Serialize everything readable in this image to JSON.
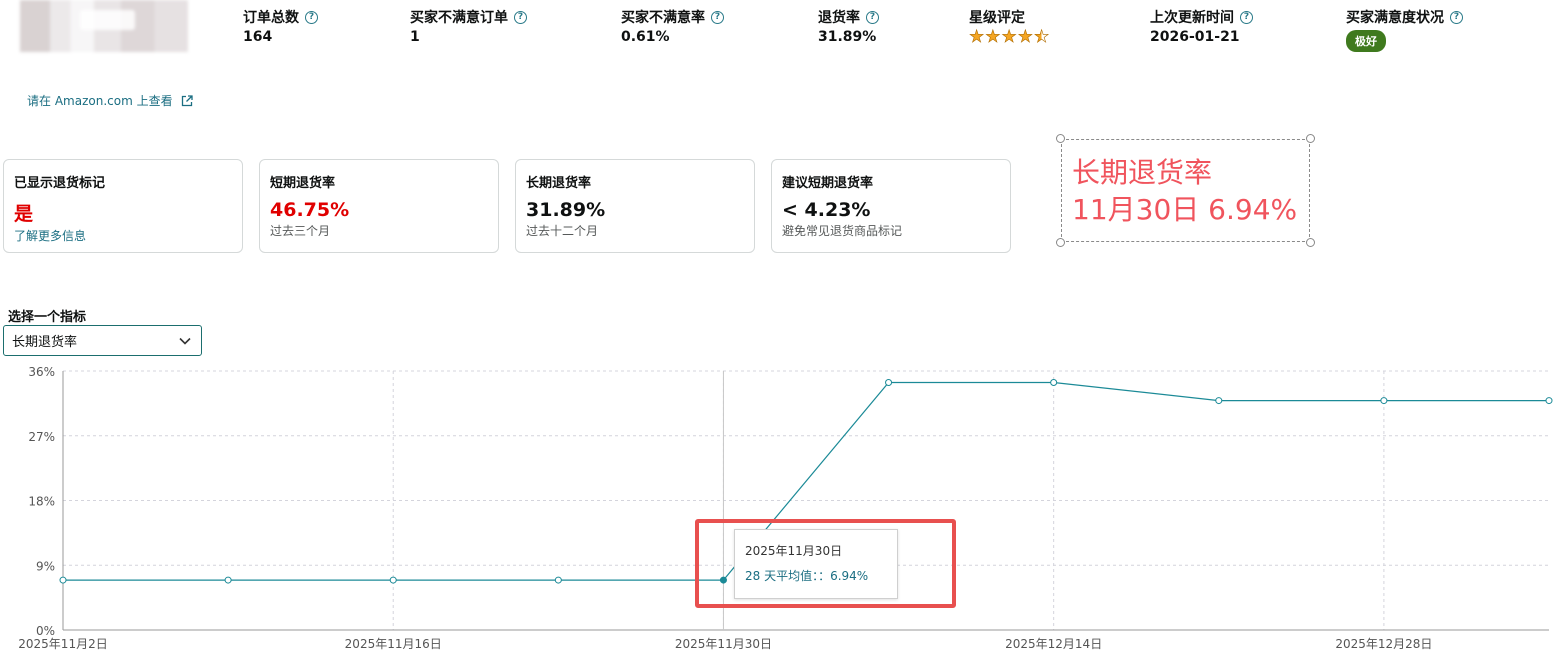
{
  "metrics": [
    {
      "label": "订单总数",
      "value": "164"
    },
    {
      "label": "买家不满意订单",
      "value": "1"
    },
    {
      "label": "买家不满意率",
      "value": "0.61%"
    },
    {
      "label": "退货率",
      "value": "31.89%"
    },
    {
      "label": "星级评定",
      "rating": 4.5
    },
    {
      "label": "上次更新时间",
      "value": "2026-01-21"
    },
    {
      "label": "买家满意度状况",
      "badge": "极好"
    }
  ],
  "amazon_link": "请在 Amazon.com 上查看",
  "cards": [
    {
      "title": "已显示退货标记",
      "value": "是",
      "sub": "了解更多信息"
    },
    {
      "title": "短期退货率",
      "value": "46.75%",
      "sub": "过去三个月"
    },
    {
      "title": "长期退货率",
      "value": "31.89%",
      "sub": "过去十二个月"
    },
    {
      "title": "建议短期退货率",
      "value": "< 4.23%",
      "sub": "避免常见退货商品标记"
    }
  ],
  "annotation": {
    "line1": "长期退货率",
    "line2": "11月30日 6.94%"
  },
  "selector": {
    "label": "选择一个指标",
    "selected": "长期退货率"
  },
  "tooltip": {
    "date": "2025年11月30日",
    "value": "28 天平均值：：6.94%"
  },
  "colors": {
    "line": "#1b8a97",
    "accent_red": "#e00000",
    "badge_green": "#3f7a1e",
    "annotation_red": "#f0545d",
    "highlight_box": "#e8504f"
  },
  "chart_data": {
    "type": "line",
    "y_ticks": [
      "36%",
      "27%",
      "18%",
      "9%",
      "0%"
    ],
    "ylim": [
      0,
      36
    ],
    "x_ticks": [
      "2025年11月2日",
      "2025年11月16日",
      "2025年11月30日",
      "2025年12月14日",
      "2025年12月28日"
    ],
    "series": [
      {
        "points": [
          {
            "x": "2025-11-02",
            "y": 6.94
          },
          {
            "x": "2025-11-09",
            "y": 6.94
          },
          {
            "x": "2025-11-16",
            "y": 6.94
          },
          {
            "x": "2025-11-23",
            "y": 6.94
          },
          {
            "x": "2025-11-30",
            "y": 6.94
          },
          {
            "x": "2025-12-07",
            "y": 34.4
          },
          {
            "x": "2025-12-14",
            "y": 34.4
          },
          {
            "x": "2025-12-21",
            "y": 31.89
          },
          {
            "x": "2025-12-28",
            "y": 31.89
          },
          {
            "x": "2026-01-04",
            "y": 31.89
          }
        ]
      }
    ],
    "highlighted_x": "2025-11-30",
    "grid": true
  }
}
